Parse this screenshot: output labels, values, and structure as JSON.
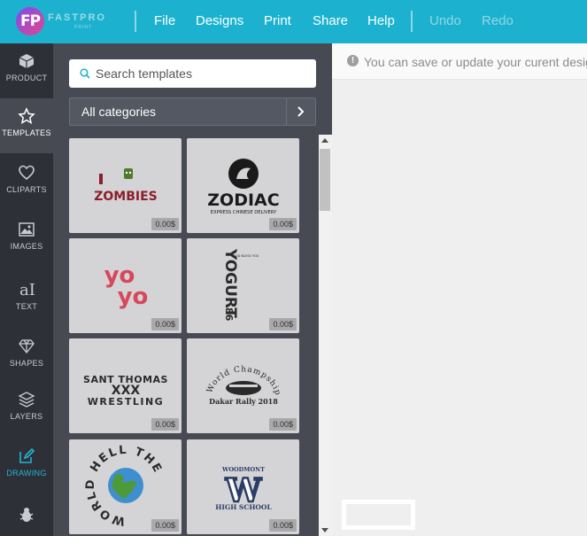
{
  "logo": {
    "initials": "FP",
    "name": "FASTPRO",
    "sub": "PRINT"
  },
  "menu": {
    "file": "File",
    "designs": "Designs",
    "print": "Print",
    "share": "Share",
    "help": "Help",
    "undo": "Undo",
    "redo": "Redo"
  },
  "rail": [
    {
      "label": "PRODUCT",
      "icon": "cube-icon"
    },
    {
      "label": "TEMPLATES",
      "icon": "star-icon"
    },
    {
      "label": "CLIPARTS",
      "icon": "heart-icon"
    },
    {
      "label": "IMAGES",
      "icon": "image-icon"
    },
    {
      "label": "TEXT",
      "icon": "text-icon"
    },
    {
      "label": "SHAPES",
      "icon": "diamond-icon"
    },
    {
      "label": "LAYERS",
      "icon": "layers-icon"
    },
    {
      "label": "DRAWING",
      "icon": "pencil-icon"
    },
    {
      "label": "",
      "icon": "bug-icon"
    }
  ],
  "search": {
    "placeholder": "Search templates"
  },
  "category": {
    "selected": "All categories"
  },
  "templates": [
    {
      "name": "I ZOMBIES",
      "line1": "I",
      "line2": "ZOMBIES",
      "price": "0.00$"
    },
    {
      "name": "ZODIAC",
      "line1": "ZODIAC",
      "line2": "EXPRESS CHINESE DELIVERY",
      "price": "0.00$"
    },
    {
      "name": "yo yo",
      "line1": "yo",
      "line2": "yo",
      "price": "0.00$"
    },
    {
      "name": "YOGURT 86",
      "line1": "YOGURT",
      "line2": "86",
      "line3": "GOD BLESS YOU",
      "price": "0.00$"
    },
    {
      "name": "SANT THOMAS WRESTLING",
      "line1": "SANT THOMAS",
      "line2": "XXX",
      "line3": "WRESTLING",
      "price": "0.00$"
    },
    {
      "name": "World Champship",
      "line1": "World Champship",
      "line2": "Dakar Rally 2018",
      "price": "0.00$"
    },
    {
      "name": "WORLD HELL THE",
      "line1": "WORLD HELL THE",
      "price": "0.00$"
    },
    {
      "name": "WOODMONT HIGH SCHOOL",
      "line1": "WOODMONT",
      "line2": "W",
      "line3": "HIGH SCHOOL",
      "price": "0.00$"
    }
  ],
  "notice": {
    "text": "You can save or update your curent design"
  },
  "colors": {
    "topbar": "#1cb2cf",
    "rail": "#2e3038",
    "panel": "#474a53",
    "accent": "#23b5d3"
  }
}
